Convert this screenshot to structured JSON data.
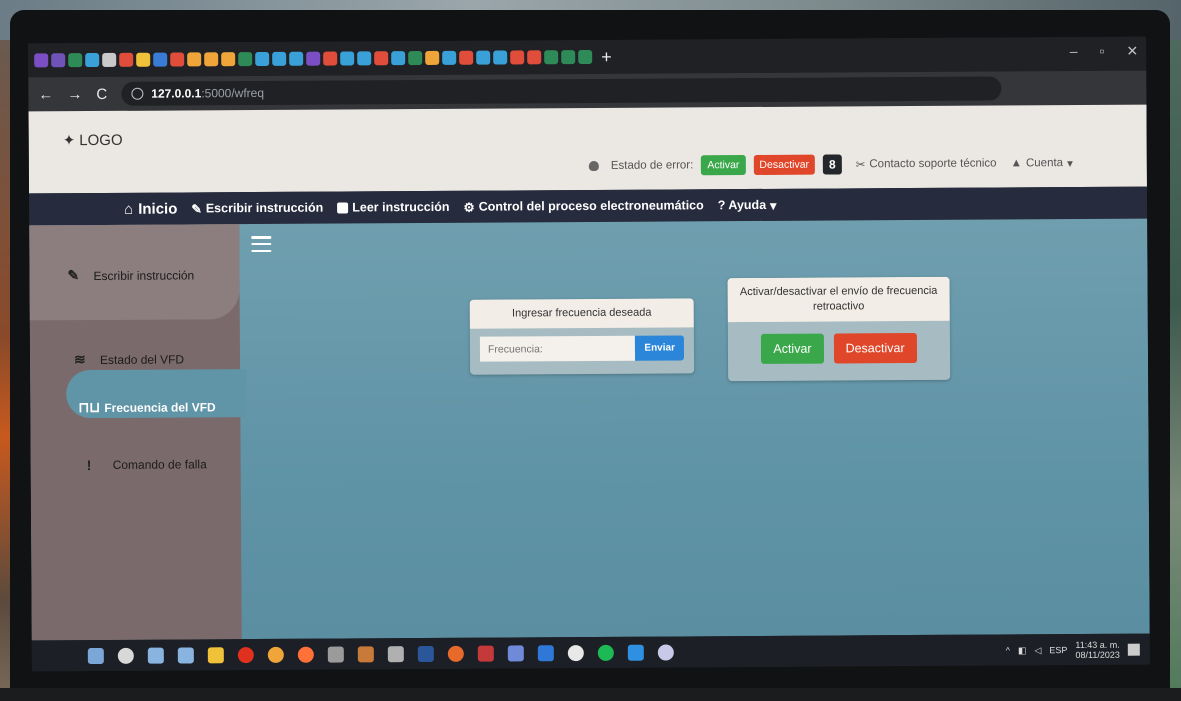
{
  "browser": {
    "url_host": "127.0.0.1",
    "url_path": ":5000/wfreq",
    "new_tab": "+"
  },
  "header": {
    "logo_text": "LOGO",
    "error_state_label": "Estado de error:",
    "activate_label": "Activar",
    "deactivate_label": "Desactivar",
    "error_count": "8",
    "support_label": "Contacto soporte técnico",
    "account_label": "Cuenta"
  },
  "nav": {
    "home": "Inicio",
    "write": "Escribir instrucción",
    "read": "Leer instrucción",
    "control": "Control del proceso electroneumático",
    "help": "? Ayuda"
  },
  "sidebar": {
    "items": [
      {
        "label": "Escribir instrucción",
        "icon": "edit-icon"
      },
      {
        "label": "Estado del VFD",
        "icon": "layers-icon"
      },
      {
        "label": "Frecuencia del VFD",
        "icon": "waveform-icon",
        "active": true
      },
      {
        "label": "Comando de falla",
        "icon": "exclamation-icon"
      }
    ]
  },
  "freq_card": {
    "title": "Ingresar frecuencia deseada",
    "placeholder": "Frecuencia:",
    "send_label": "Enviar"
  },
  "feedback_card": {
    "title": "Activar/desactivar el envío de frecuencia retroactivo",
    "activate_label": "Activar",
    "deactivate_label": "Desactivar"
  },
  "taskbar": {
    "lang": "ESP",
    "time": "11:43 a. m.",
    "date": "08/11/2023"
  },
  "colors": {
    "header_bg": "#ebe7e3",
    "navbar_bg": "#262b3d",
    "content_bg": "#6a9aac",
    "sidebar_bg": "#7b6a6c",
    "success": "#3aa84a",
    "danger": "#e0472a",
    "primary": "#2b86d9"
  }
}
